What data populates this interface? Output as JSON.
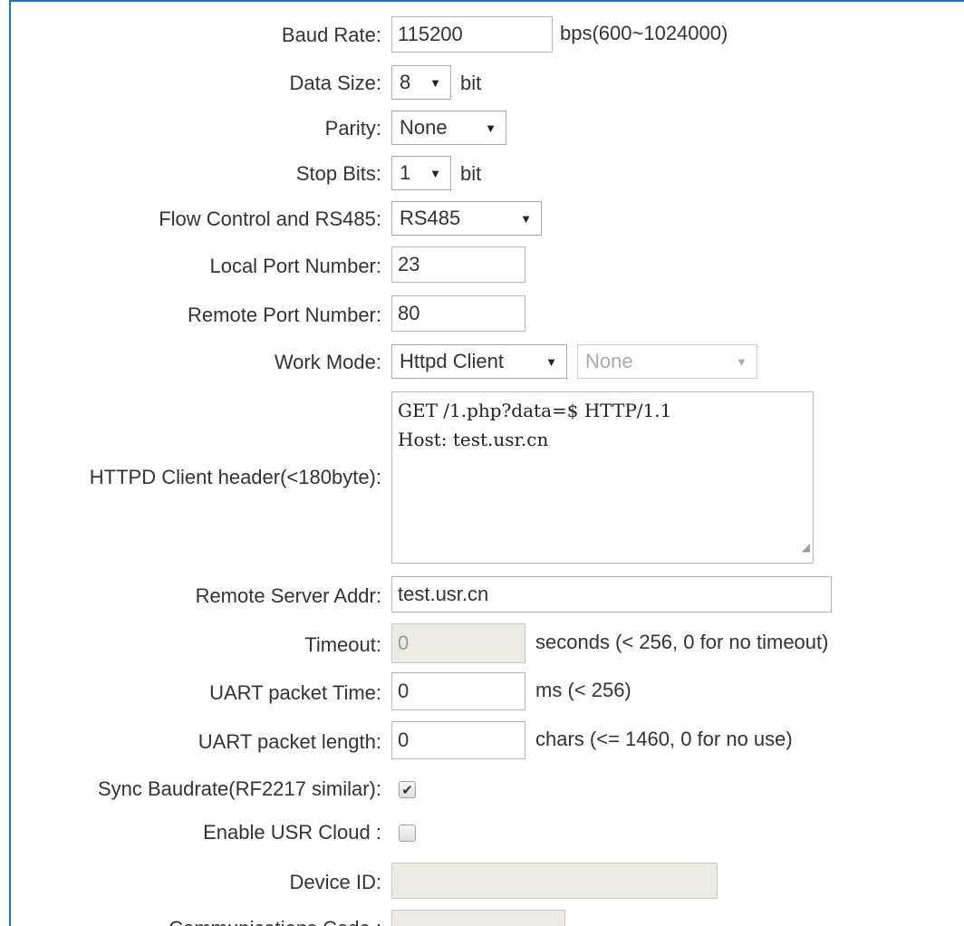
{
  "fields": {
    "baud_rate": {
      "label": "Baud Rate:",
      "value": "115200",
      "hint": "bps(600~1024000)"
    },
    "data_size": {
      "label": "Data Size:",
      "value": "8",
      "unit": "bit"
    },
    "parity": {
      "label": "Parity:",
      "value": "None"
    },
    "stop_bits": {
      "label": "Stop Bits:",
      "value": "1",
      "unit": "bit"
    },
    "flow_control": {
      "label": "Flow Control and RS485:",
      "value": "RS485"
    },
    "local_port": {
      "label": "Local Port Number:",
      "value": "23"
    },
    "remote_port": {
      "label": "Remote Port Number:",
      "value": "80"
    },
    "work_mode": {
      "label": "Work Mode:",
      "value": "Httpd Client",
      "secondary_value": "None"
    },
    "httpd_header": {
      "label": "HTTPD Client header(<180byte):",
      "line1": "GET /1.php?data=$ HTTP/1.1",
      "line2": "Host: test.usr.cn"
    },
    "remote_server": {
      "label": "Remote Server Addr:",
      "value": "test.usr.cn"
    },
    "timeout": {
      "label": "Timeout:",
      "value": "0",
      "hint": "seconds (< 256, 0 for no timeout)"
    },
    "uart_time": {
      "label": "UART packet Time:",
      "value": "0",
      "hint": "ms (< 256)"
    },
    "uart_length": {
      "label": "UART packet length:",
      "value": "0",
      "hint": "chars (<= 1460, 0 for no use)"
    },
    "sync_baud": {
      "label": "Sync Baudrate(RF2217 similar):",
      "checked": true,
      "check_glyph": "✔"
    },
    "usr_cloud": {
      "label": "Enable USR Cloud :",
      "checked": false
    },
    "device_id": {
      "label": "Device ID:",
      "value": ""
    },
    "comm_code": {
      "label": "Communications Code :",
      "value": ""
    }
  },
  "icons": {
    "dropdown_arrow": "▼"
  },
  "colors": {
    "frame": "#1a78c2",
    "disabled_bg": "#ebebe4"
  }
}
